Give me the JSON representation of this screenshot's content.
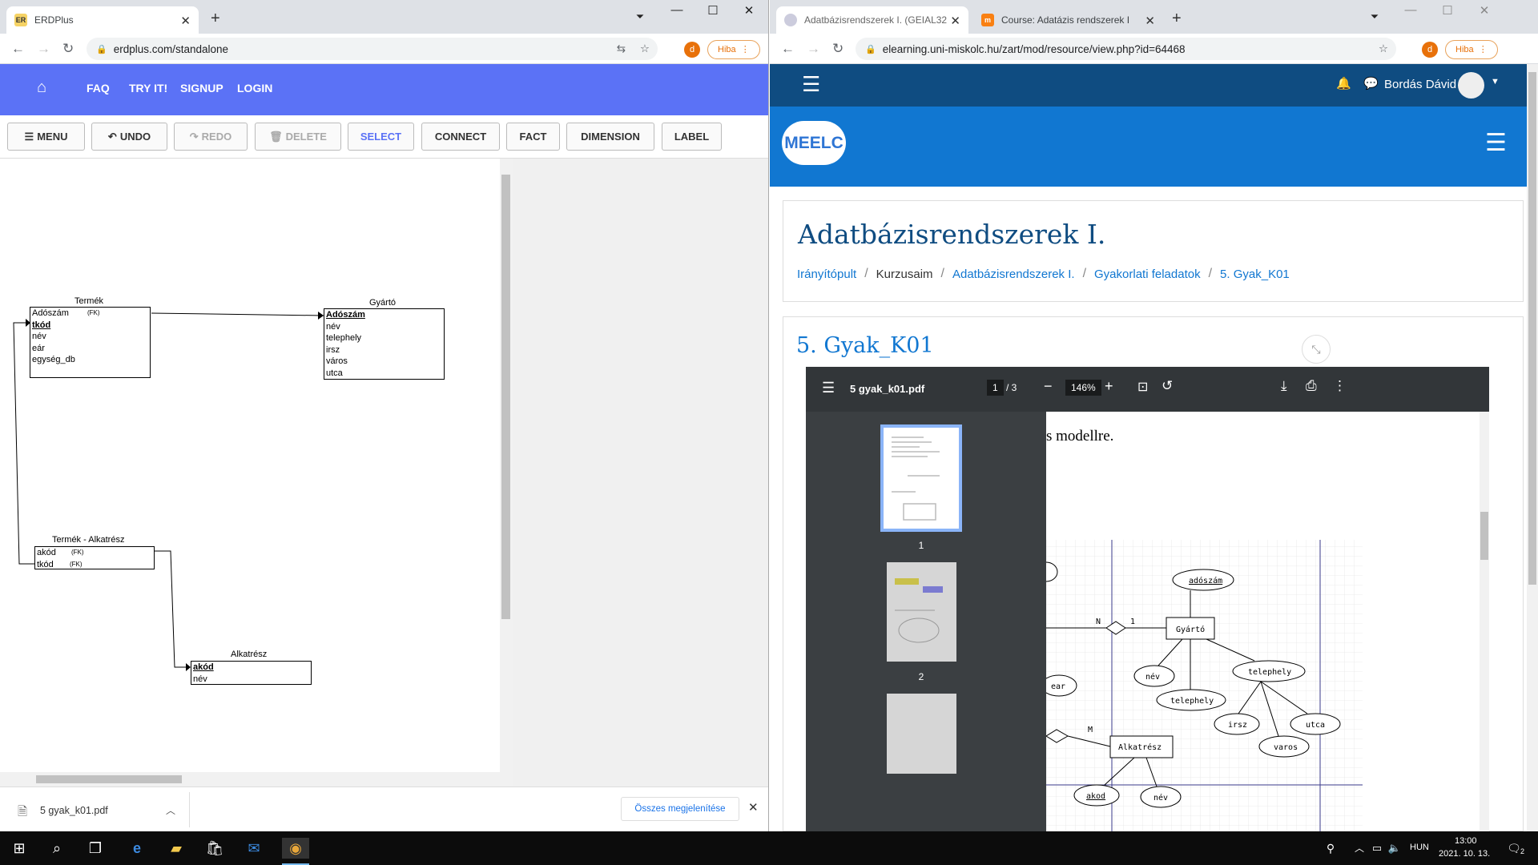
{
  "left_window": {
    "tab_title": "ERDPlus",
    "tab_favicon": "ER",
    "url": "erdplus.com/standalone",
    "profile_letter": "d",
    "error_chip": "Hiba",
    "nav": {
      "faq": "FAQ",
      "try": "TRY IT!",
      "signup": "SIGNUP",
      "login": "LOGIN"
    },
    "toolbar": {
      "menu": "MENU",
      "undo": "UNDO",
      "redo": "REDO",
      "delete": "DELETE",
      "select": "SELECT",
      "connect": "CONNECT",
      "fact": "FACT",
      "dimension": "DIMENSION",
      "label": "LABEL"
    },
    "tables": {
      "termek": {
        "name": "Termék",
        "attrs": [
          "Adószám",
          "tkód",
          "név",
          "eár",
          "egység_db"
        ],
        "fk_label": "(FK)"
      },
      "gyarto": {
        "name": "Gyártó",
        "attrs": [
          "Adószám",
          "név",
          "telephely",
          "irsz",
          "város",
          "utca"
        ]
      },
      "termek_alkatresz": {
        "name": "Termék - Alkatrész",
        "attrs": [
          "akód",
          "tkód"
        ],
        "fk_label": "(FK)"
      },
      "alkatresz": {
        "name": "Alkatrész",
        "attrs": [
          "akód",
          "név"
        ]
      }
    },
    "download": {
      "file": "5 gyak_k01.pdf",
      "show_all": "Összes megjelenítése"
    }
  },
  "right_window": {
    "tab1_title": "Adatbázisrendszerek I. (GEIAL32",
    "tab2_title": "Course: Adatázis rendszerek I",
    "url": "elearning.uni-miskolc.hu/zart/mod/resource/view.php?id=64468",
    "profile_letter": "d",
    "error_chip": "Hiba",
    "user_name": "Bordás Dávid",
    "logo": "MEELC",
    "course_title": "Adatbázisrendszerek I.",
    "breadcrumb": [
      "Irányítópult",
      "Kurzusaim",
      "Adatbázisrendszerek I.",
      "Gyakorlati feladatok",
      "5. Gyak_K01"
    ],
    "section_title": "5. Gyak_K01",
    "pdf": {
      "filename": "5 gyak_k01.pdf",
      "page": "1",
      "page_total": "/ 3",
      "zoom": "146%",
      "thumbs": [
        "1",
        "2"
      ],
      "text_fragment": "s modellre.",
      "diagram": {
        "n_label": "N",
        "one_label": "1",
        "m_label": "M",
        "gyarto": "Gyártó",
        "adoszam": "adószám",
        "nev": "név",
        "telephely": "telephely",
        "telephely2": "telephely",
        "irsz": "irsz",
        "utca": "utca",
        "varos": "varos",
        "ear": "ear",
        "alkatresz": "Alkatrész",
        "akod": "akod",
        "nev2": "név"
      }
    }
  },
  "taskbar": {
    "lang": "HUN",
    "time": "13:00",
    "date": "2021. 10. 13.",
    "notif": "2"
  }
}
